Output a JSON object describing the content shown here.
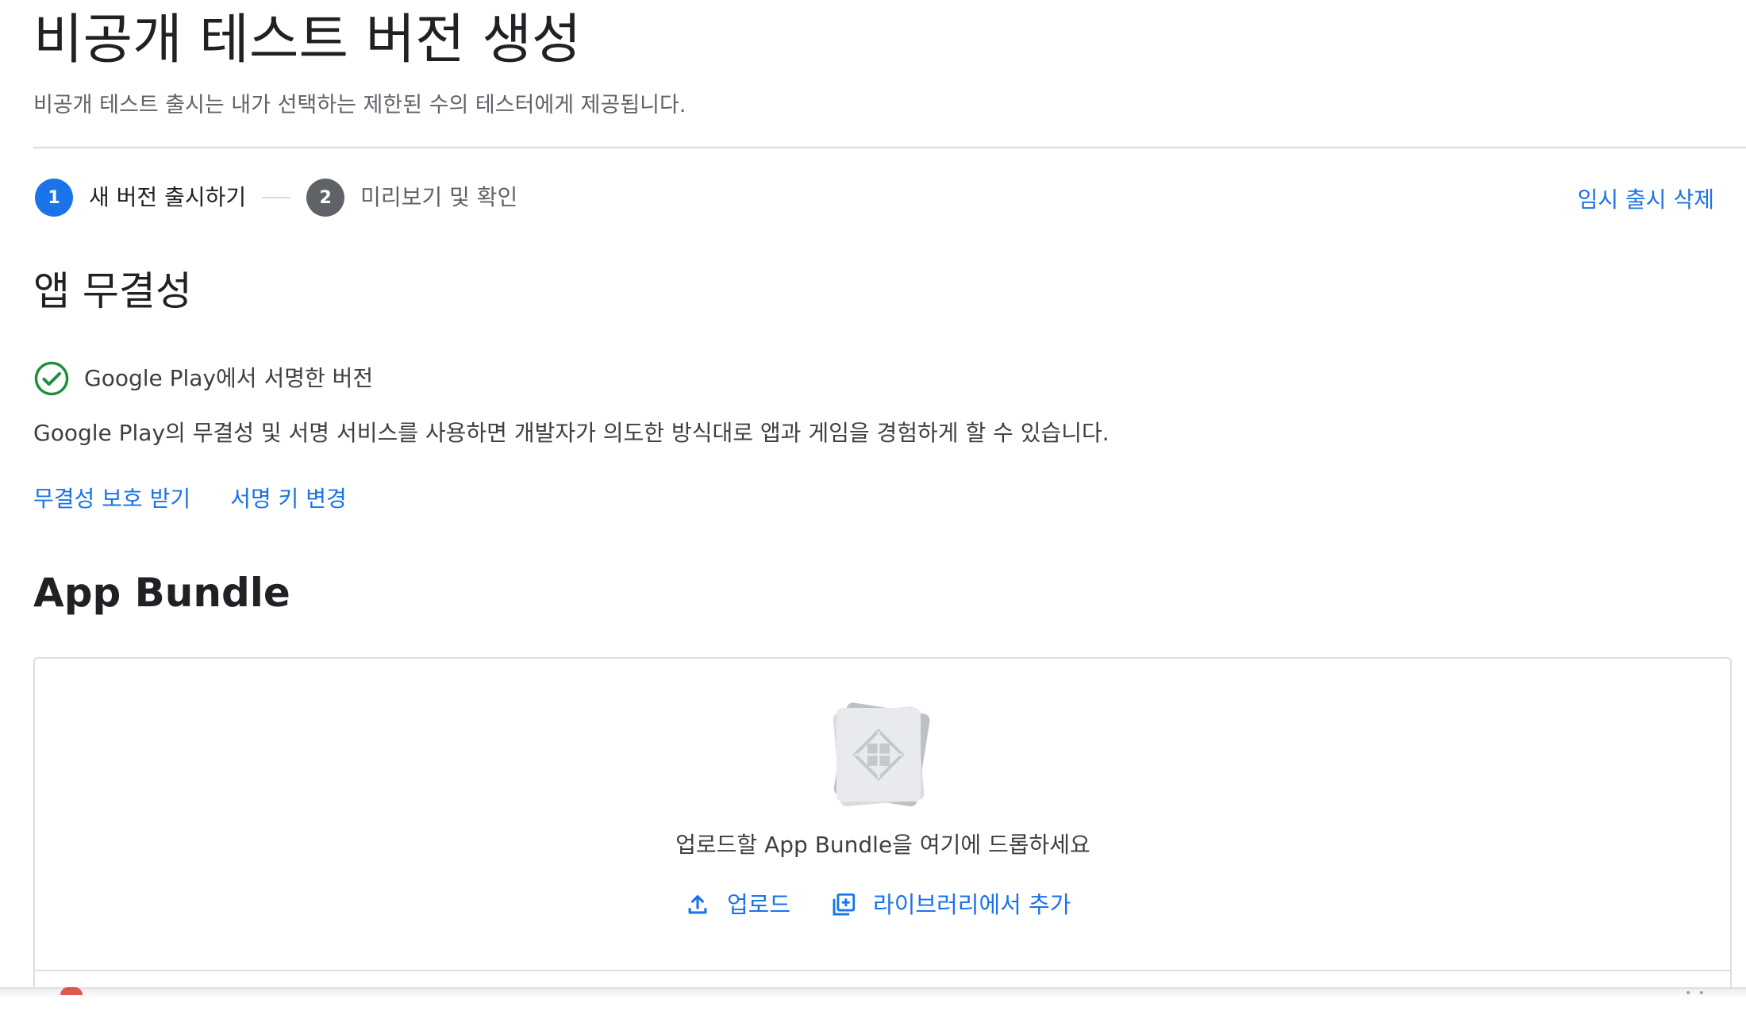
{
  "page": {
    "title": "비공개 테스트 버전 생성",
    "subtitle": "비공개 테스트 출시는 내가 선택하는 제한된 수의 테스터에게 제공됩니다."
  },
  "stepper": {
    "steps": [
      {
        "number": "1",
        "label": "새 버전 출시하기",
        "state": "active"
      },
      {
        "number": "2",
        "label": "미리보기 및 확인",
        "state": "inactive"
      }
    ],
    "discard_label": "임시 출시 삭제"
  },
  "integrity": {
    "title": "앱 무결성",
    "signed_status": "Google Play에서 서명한 버전",
    "description": "Google Play의 무결성 및 서명 서비스를 사용하면 개발자가 의도한 방식대로 앱과 게임을 경험하게 할 수 있습니다.",
    "links": {
      "protect": "무결성 보호 받기",
      "change_key": "서명 키 변경"
    }
  },
  "app_bundle": {
    "title": "App Bundle",
    "drop_text": "업로드할 App Bundle을 여기에 드롭하세요",
    "upload_label": "업로드",
    "library_label": "라이브러리에서 추가"
  },
  "icons": {
    "signed": "check-circle-icon",
    "upload": "upload-icon",
    "library": "library-add-icon",
    "bundle": "app-bundle-icon"
  },
  "colors": {
    "accent": "#1a73e8",
    "success": "#1e8e3e",
    "inactive_step": "#5f6368",
    "error": "#d93025"
  }
}
